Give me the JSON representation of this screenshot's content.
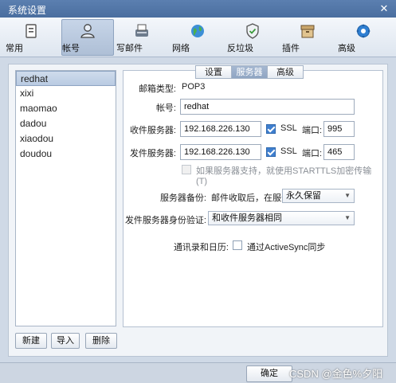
{
  "window": {
    "title": "系统设置",
    "close_glyph": "✕"
  },
  "toolbar": {
    "items": [
      {
        "label": "常用",
        "icon": "general-icon"
      },
      {
        "label": "帐号",
        "icon": "account-icon"
      },
      {
        "label": "写邮件",
        "icon": "compose-icon"
      },
      {
        "label": "网络",
        "icon": "network-icon"
      },
      {
        "label": "反垃圾",
        "icon": "antispam-icon"
      },
      {
        "label": "插件",
        "icon": "plugin-icon"
      },
      {
        "label": "高级",
        "icon": "advanced-icon"
      }
    ],
    "active": "帐号"
  },
  "accounts": {
    "items": [
      "redhat",
      "xixi",
      "maomao",
      "dadou",
      "xiaodou",
      "doudou"
    ],
    "selected": "redhat",
    "buttons": {
      "new": "新建",
      "import": "导入",
      "delete": "删除"
    }
  },
  "tabs": {
    "items": [
      "设置",
      "服务器",
      "高级"
    ],
    "active": "服务器"
  },
  "server": {
    "mailbox_type_label": "邮箱类型:",
    "mailbox_type_value": "POP3",
    "account_label": "帐号:",
    "account_value": "redhat",
    "incoming_label": "收件服务器:",
    "incoming_value": "192.168.226.130",
    "incoming_ssl_label": "SSL",
    "incoming_ssl_checked": true,
    "incoming_port_label": "端口:",
    "incoming_port_value": "995",
    "outgoing_label": "发件服务器:",
    "outgoing_value": "192.168.226.130",
    "outgoing_ssl_label": "SSL",
    "outgoing_ssl_checked": true,
    "outgoing_port_label": "端口:",
    "outgoing_port_value": "465",
    "starttls_label": "如果服务器支持，就使用STARTTLS加密传输(T)",
    "starttls_checked": false,
    "backup_label": "服务器备份:",
    "backup_desc": "邮件收取后，在服务器上",
    "backup_value": "永久保留",
    "auth_label": "发件服务器身份验证:",
    "auth_value": "和收件服务器相同",
    "sync_label": "通讯录和日历:",
    "sync_option_label": "通过ActiveSync同步",
    "sync_checked": false
  },
  "footer": {
    "ok": "确定",
    "watermark": "CSDN @金色%夕阳"
  },
  "colors": {
    "accent": "#3f7fcf",
    "titlebar": "#4a6e9f"
  }
}
